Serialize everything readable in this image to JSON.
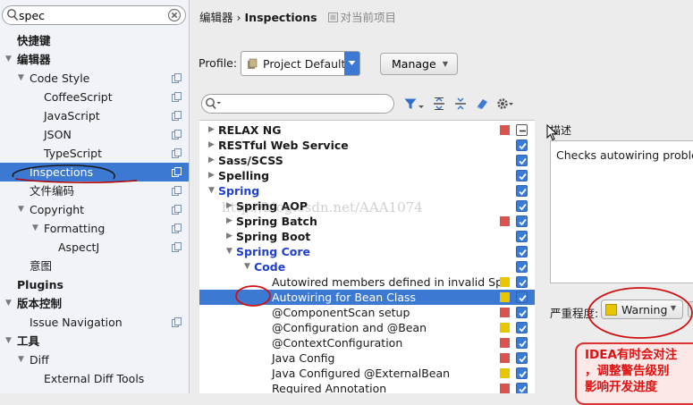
{
  "sidebar": {
    "search_value": "spec",
    "items": [
      {
        "label": "快捷键",
        "indent": 0,
        "arrow": "",
        "bold": true,
        "copy": false
      },
      {
        "label": "编辑器",
        "indent": 0,
        "arrow": "▼",
        "bold": true,
        "copy": false
      },
      {
        "label": "Code Style",
        "indent": 1,
        "arrow": "▼",
        "bold": false,
        "copy": true
      },
      {
        "label": "CoffeeScript",
        "indent": 2,
        "arrow": "",
        "bold": false,
        "copy": true
      },
      {
        "label": "JavaScript",
        "indent": 2,
        "arrow": "",
        "bold": false,
        "copy": true
      },
      {
        "label": "JSON",
        "indent": 2,
        "arrow": "",
        "bold": false,
        "copy": true
      },
      {
        "label": "TypeScript",
        "indent": 2,
        "arrow": "",
        "bold": false,
        "copy": true
      },
      {
        "label": "Inspections",
        "indent": 1,
        "arrow": "",
        "bold": false,
        "copy": true,
        "selected": true
      },
      {
        "label": "文件编码",
        "indent": 1,
        "arrow": "",
        "bold": false,
        "copy": true
      },
      {
        "label": "Copyright",
        "indent": 1,
        "arrow": "▼",
        "bold": false,
        "copy": true
      },
      {
        "label": "Formatting",
        "indent": 2,
        "arrow": "▼",
        "bold": false,
        "copy": true
      },
      {
        "label": "AspectJ",
        "indent": 3,
        "arrow": "",
        "bold": false,
        "copy": true
      },
      {
        "label": "意图",
        "indent": 1,
        "arrow": "",
        "bold": false,
        "copy": false
      },
      {
        "label": "Plugins",
        "indent": 0,
        "arrow": "",
        "bold": true,
        "copy": false
      },
      {
        "label": "版本控制",
        "indent": 0,
        "arrow": "▼",
        "bold": true,
        "copy": false
      },
      {
        "label": "Issue Navigation",
        "indent": 1,
        "arrow": "",
        "bold": false,
        "copy": true
      },
      {
        "label": "工具",
        "indent": 0,
        "arrow": "▼",
        "bold": true,
        "copy": false
      },
      {
        "label": "Diff",
        "indent": 1,
        "arrow": "▼",
        "bold": false,
        "copy": false
      },
      {
        "label": "External Diff Tools",
        "indent": 2,
        "arrow": "",
        "bold": false,
        "copy": false
      }
    ]
  },
  "breadcrumb": {
    "part1": "编辑器",
    "separator": "›",
    "part2": "Inspections",
    "project_note": "对当前项目"
  },
  "profile": {
    "label": "Profile:",
    "value": "Project Default",
    "manage_label": "Manage"
  },
  "inspections": [
    {
      "label": "RELAX NG",
      "indent": 0,
      "arrow": "▶",
      "style": "bold",
      "sev": "#d9534f",
      "check": "mixed"
    },
    {
      "label": "RESTful Web Service",
      "indent": 0,
      "arrow": "▶",
      "style": "bold",
      "sev": "",
      "check": "on"
    },
    {
      "label": "Sass/SCSS",
      "indent": 0,
      "arrow": "▶",
      "style": "bold",
      "sev": "",
      "check": "on"
    },
    {
      "label": "Spelling",
      "indent": 0,
      "arrow": "▶",
      "style": "bold",
      "sev": "",
      "check": "on"
    },
    {
      "label": "Spring",
      "indent": 0,
      "arrow": "▼",
      "style": "blue",
      "sev": "",
      "check": "on"
    },
    {
      "label": "Spring AOP",
      "indent": 1,
      "arrow": "▶",
      "style": "bold",
      "sev": "",
      "check": "on"
    },
    {
      "label": "Spring Batch",
      "indent": 1,
      "arrow": "▶",
      "style": "bold",
      "sev": "#d9534f",
      "check": "on"
    },
    {
      "label": "Spring Boot",
      "indent": 1,
      "arrow": "▶",
      "style": "bold",
      "sev": "",
      "check": "on"
    },
    {
      "label": "Spring Core",
      "indent": 1,
      "arrow": "▼",
      "style": "blue",
      "sev": "",
      "check": "on"
    },
    {
      "label": "Code",
      "indent": 2,
      "arrow": "▼",
      "style": "blue",
      "sev": "",
      "check": "on"
    },
    {
      "label": "Autowired members defined in invalid Spri",
      "indent": 3,
      "arrow": "",
      "style": "normal",
      "sev": "#e9c400",
      "check": "on"
    },
    {
      "label": "Autowiring for Bean Class",
      "indent": 3,
      "arrow": "",
      "style": "normal",
      "sev": "#e9c400",
      "check": "on",
      "selected": true
    },
    {
      "label": "@ComponentScan setup",
      "indent": 3,
      "arrow": "",
      "style": "normal",
      "sev": "#d9534f",
      "check": "on"
    },
    {
      "label": "@Configuration and @Bean",
      "indent": 3,
      "arrow": "",
      "style": "normal",
      "sev": "#e9c400",
      "check": "on"
    },
    {
      "label": "@ContextConfiguration",
      "indent": 3,
      "arrow": "",
      "style": "normal",
      "sev": "#d9534f",
      "check": "on"
    },
    {
      "label": "Java Config",
      "indent": 3,
      "arrow": "",
      "style": "normal",
      "sev": "#d9534f",
      "check": "on"
    },
    {
      "label": "Java Configured @ExternalBean",
      "indent": 3,
      "arrow": "",
      "style": "normal",
      "sev": "#e9c400",
      "check": "on"
    },
    {
      "label": "Required Annotation",
      "indent": 3,
      "arrow": "",
      "style": "normal",
      "sev": "#d9534f",
      "check": "on"
    }
  ],
  "description": {
    "label": "描述",
    "text": "Checks autowiring probler"
  },
  "severity": {
    "label": "严重程度:",
    "value": "Warning"
  },
  "annotation": {
    "line1": "IDEA有时会对注",
    "line2": "，调整警告级别",
    "line3": "影响开发进度"
  },
  "watermark": "http://blog.csdn.net/AAA1074",
  "colors": {
    "accent": "#3c79d3",
    "error": "#d9534f",
    "warning": "#e9c400",
    "annotation": "#e01010"
  }
}
